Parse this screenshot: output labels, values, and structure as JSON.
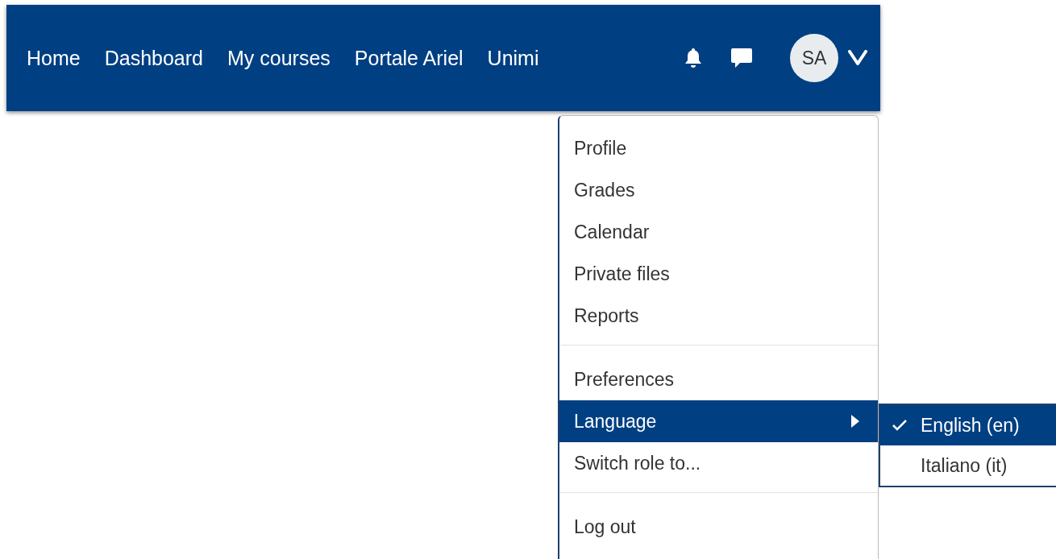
{
  "navbar": {
    "links": [
      {
        "label": "Home"
      },
      {
        "label": "Dashboard"
      },
      {
        "label": "My courses"
      },
      {
        "label": "Portale Ariel"
      },
      {
        "label": "Unimi"
      }
    ],
    "avatar": "SA"
  },
  "user_menu": {
    "groups": [
      [
        {
          "label": "Profile",
          "selected": false,
          "has_submenu": false
        },
        {
          "label": "Grades",
          "selected": false,
          "has_submenu": false
        },
        {
          "label": "Calendar",
          "selected": false,
          "has_submenu": false
        },
        {
          "label": "Private files",
          "selected": false,
          "has_submenu": false
        },
        {
          "label": "Reports",
          "selected": false,
          "has_submenu": false
        }
      ],
      [
        {
          "label": "Preferences",
          "selected": false,
          "has_submenu": false
        },
        {
          "label": "Language",
          "selected": true,
          "has_submenu": true
        },
        {
          "label": "Switch role to...",
          "selected": false,
          "has_submenu": false
        }
      ],
      [
        {
          "label": "Log out",
          "selected": false,
          "has_submenu": false
        }
      ]
    ]
  },
  "language_submenu": [
    {
      "label": "English (en)",
      "selected": true,
      "checked": true
    },
    {
      "label": "Italiano (it)",
      "selected": false,
      "checked": false
    }
  ]
}
